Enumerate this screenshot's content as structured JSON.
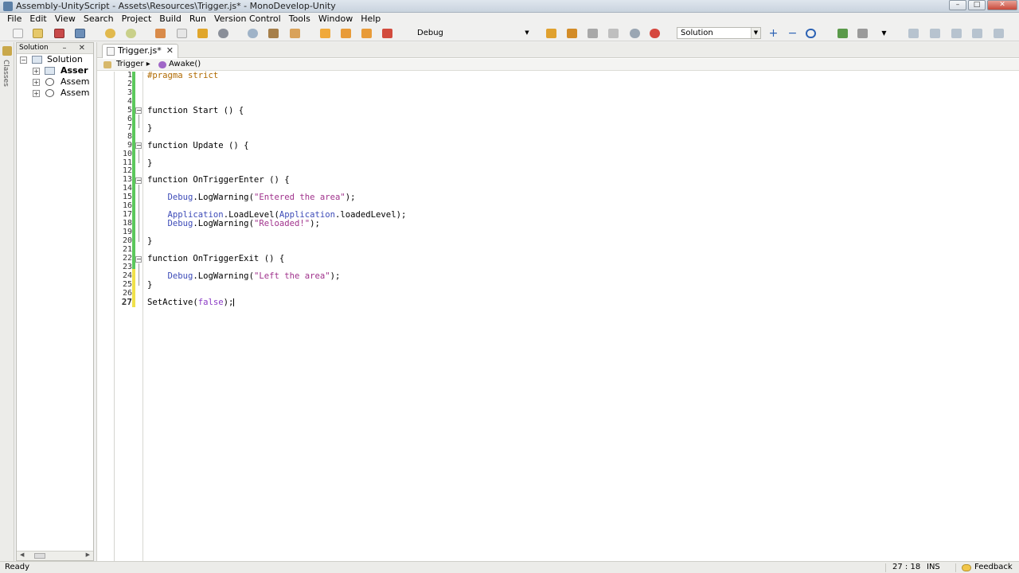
{
  "window": {
    "title": "Assembly-UnityScript - Assets\\Resources\\Trigger.js* - MonoDevelop-Unity",
    "minimize": "–",
    "maximize": "□",
    "close": "✕"
  },
  "menu": [
    "File",
    "Edit",
    "View",
    "Search",
    "Project",
    "Build",
    "Run",
    "Version Control",
    "Tools",
    "Window",
    "Help"
  ],
  "toolbar": {
    "configuration": "Debug",
    "scope": "Solution"
  },
  "dock": {
    "classes_label": "Classes"
  },
  "solution_pad": {
    "title": "Solution",
    "buttons": "– ✕",
    "tree": [
      {
        "label": "Solution",
        "bold": false,
        "expanded": true
      },
      {
        "label": "Asser",
        "bold": true,
        "expanded": false
      },
      {
        "label": "Assem",
        "bold": false,
        "expanded": false
      },
      {
        "label": "Assem",
        "bold": false,
        "expanded": false
      }
    ]
  },
  "editor": {
    "tab_label": "Trigger.js*",
    "tab_close": "✕",
    "path": {
      "class": "Trigger",
      "member": "Awake()",
      "separator": "▸"
    },
    "line_numbers": [
      "1",
      "2",
      "3",
      "4",
      "5",
      "6",
      "7",
      "8",
      "9",
      "10",
      "11",
      "12",
      "13",
      "14",
      "15",
      "16",
      "17",
      "18",
      "19",
      "20",
      "21",
      "22",
      "23",
      "24",
      "25",
      "26",
      "27"
    ],
    "current_line": "27"
  },
  "statusbar": {
    "status": "Ready",
    "cursor": "27 : 18",
    "mode": "INS",
    "feedback": "Feedback"
  },
  "colors": {
    "change_saved": "#5cc85c",
    "change_unsaved": "#f0e14a",
    "string": "#a0328c",
    "preprocessor": "#b06a00",
    "identifier": "#3d4bb8"
  }
}
